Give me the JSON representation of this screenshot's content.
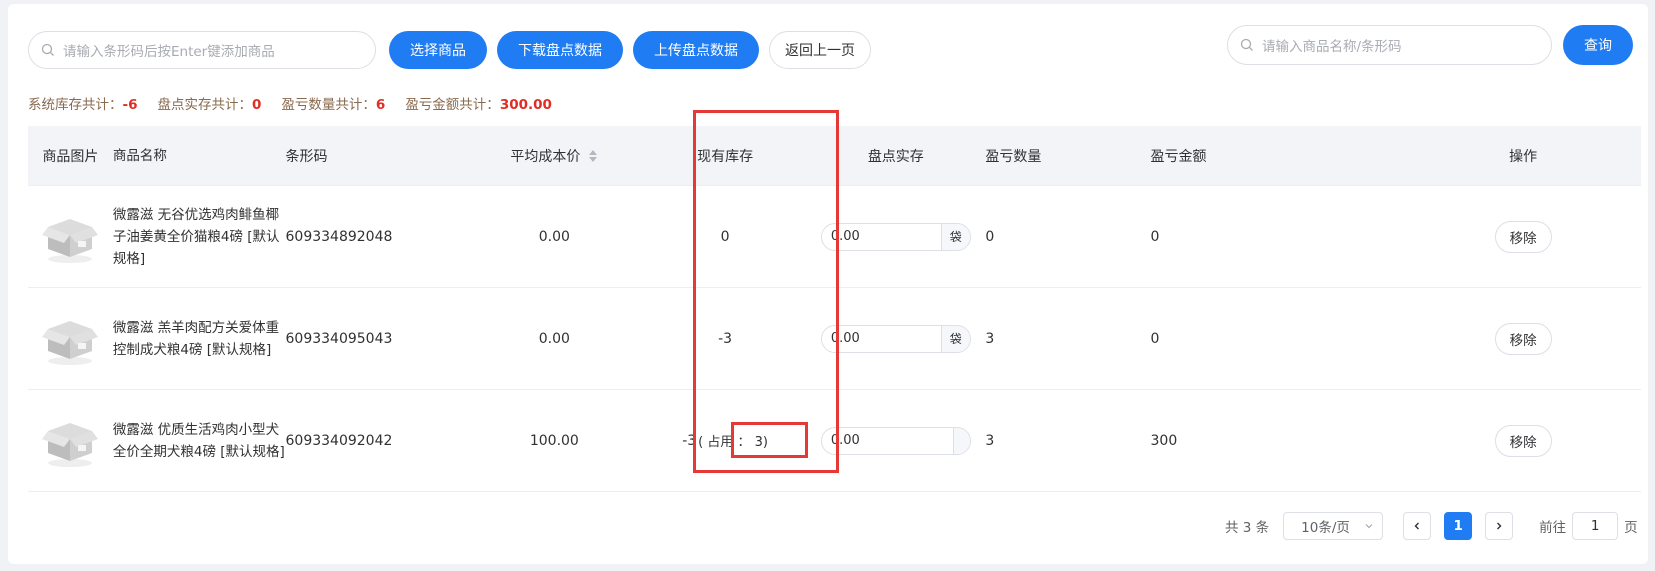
{
  "toolbar": {
    "barcode_placeholder": "请输入条形码后按Enter键添加商品",
    "select_goods": "选择商品",
    "download_data": "下载盘点数据",
    "upload_data": "上传盘点数据",
    "back": "返回上一页",
    "search_placeholder": "请输入商品名称/条形码",
    "query": "查询"
  },
  "summary": {
    "system_stock_label": "系统库存共计：",
    "system_stock_value": "-6",
    "actual_stock_label": "盘点实存共计：",
    "actual_stock_value": "0",
    "pl_qty_label": "盈亏数量共计：",
    "pl_qty_value": "6",
    "pl_amount_label": "盈亏金额共计：",
    "pl_amount_value": "300.00"
  },
  "table": {
    "headers": {
      "image": "商品图片",
      "name": "商品名称",
      "barcode": "条形码",
      "avg_cost": "平均成本价",
      "stock": "现有库存",
      "count": "盘点实存",
      "pl_qty": "盈亏数量",
      "pl_amount": "盈亏金额",
      "action": "操作"
    },
    "rows": [
      {
        "name": "微露滋 无谷优选鸡肉鲱鱼椰子油姜黄全价猫粮4磅 [默认规格]",
        "barcode": "609334892048",
        "avg_cost": "0.00",
        "stock": "0",
        "count_value": "0.00",
        "unit": "袋",
        "pl_qty": "0",
        "pl_amount": "0",
        "action": "移除"
      },
      {
        "name": "微露滋 羔羊肉配方关爱体重控制成犬粮4磅 [默认规格]",
        "barcode": "609334095043",
        "avg_cost": "0.00",
        "stock": "-3",
        "count_value": "0.00",
        "unit": "袋",
        "pl_qty": "3",
        "pl_amount": "0",
        "action": "移除"
      },
      {
        "name": "微露滋 优质生活鸡肉小型犬全价全期犬粮4磅 [默认规格]",
        "barcode": "609334092042",
        "avg_cost": "100.00",
        "stock": "-3",
        "stock_note": "( 占用 ： 3)",
        "count_value": "0.00",
        "unit": "",
        "pl_qty": "3",
        "pl_amount": "300",
        "action": "移除"
      }
    ]
  },
  "pagination": {
    "total": "共 3 条",
    "page_size": "10条/页",
    "current_page": "1",
    "goto_label": "前往",
    "goto_value": "1",
    "page_suffix": "页"
  },
  "colors": {
    "primary": "#1f7cf2",
    "danger": "#e02e24",
    "annotation": "#e53935"
  }
}
